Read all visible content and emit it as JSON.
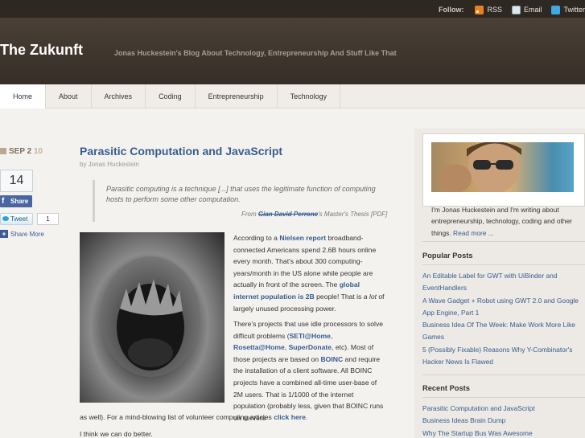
{
  "topbar": {
    "follow_label": "Follow:",
    "links": [
      {
        "label": "RSS",
        "icon": "rss-icon"
      },
      {
        "label": "Email",
        "icon": "email-icon"
      },
      {
        "label": "Twitter",
        "icon": "twitter-icon"
      }
    ]
  },
  "header": {
    "site_title": "The Zukunft",
    "tagline": "Jonas Huckestein's Blog About Technology, Entrepreneurship And Stuff Like That"
  },
  "nav": {
    "items": [
      "Home",
      "About",
      "Archives",
      "Coding",
      "Entrepreneurship",
      "Technology"
    ],
    "active": "Home"
  },
  "post": {
    "date_month_day": "SEP 2",
    "date_year": "10",
    "share_count": "14",
    "fb_share_label": "Share",
    "tweet_label": "Tweet",
    "tweet_count": "1",
    "share_more_label": "Share More",
    "title": "Parasitic Computation and JavaScript",
    "byline": "by Jonas Huckestein",
    "quote": "Parasitic computing is a technique [...] that uses the legitimate function of computing hosts to perform some other computation.",
    "cite_from": "From",
    "cite_name": "Gian David Perrone",
    "cite_rest": "'s Master's Thesis [PDF]",
    "p1": {
      "a": "According to a",
      "link1": "Nielsen report",
      "b": "broadband-connected Americans spend 2.6B hours online every month. That's about 300 computing-years/month in the US alone while people are actually in front of the screen. The",
      "link2": "global internet population is 2B",
      "c": "people! That is",
      "em": "a lot",
      "d": "of largely unused processing power."
    },
    "p2": {
      "a": "There's projects that use idle processors to solve difficult problems (",
      "link1": "SETI@Home",
      "sep1": ",",
      "link2": "Rosetta@Home",
      "sep2": ",",
      "link3": "SuperDonate",
      "b": ", etc). Most of those projects are based on",
      "link4": "BOINC",
      "c": "and require the installation of a client software. All BOINC projects have a combined all-time user-base of 2M users. That is 1/1000 of the internet population (probably less, given that BOINC runs on servers",
      "d": "as well). For a mind-blowing list of volunteer computing articles",
      "link5": "click here",
      "e": "."
    },
    "p3": "I think we can do better."
  },
  "sidebar": {
    "bio_text": "I'm Jonas Huckestein and I'm writing about entrepreneurship, technology, coding and other things.",
    "read_more": "Read more ...",
    "popular_heading": "Popular Posts",
    "popular": [
      "An Editable Label for GWT with UiBinder and EventHandlers",
      "A Wave Gadget + Robot using GWT 2.0 and Google App Engine, Part 1",
      "Business Idea Of The Week: Make Work More Like Games",
      "5 (Possibly Fixable) Reasons Why Y-Combinator's Hacker News Is Flawed"
    ],
    "recent_heading": "Recent Posts",
    "recent": [
      "Parasitic Computation and JavaScript",
      "Business Ideas Brain Dump",
      "Why The Startup Bus Was Awesome"
    ]
  },
  "colors": {
    "link": "#365d91",
    "header_bg": "#4a4036",
    "topbar_bg": "#2e2823",
    "sidebar_bg": "#ede9e4"
  }
}
